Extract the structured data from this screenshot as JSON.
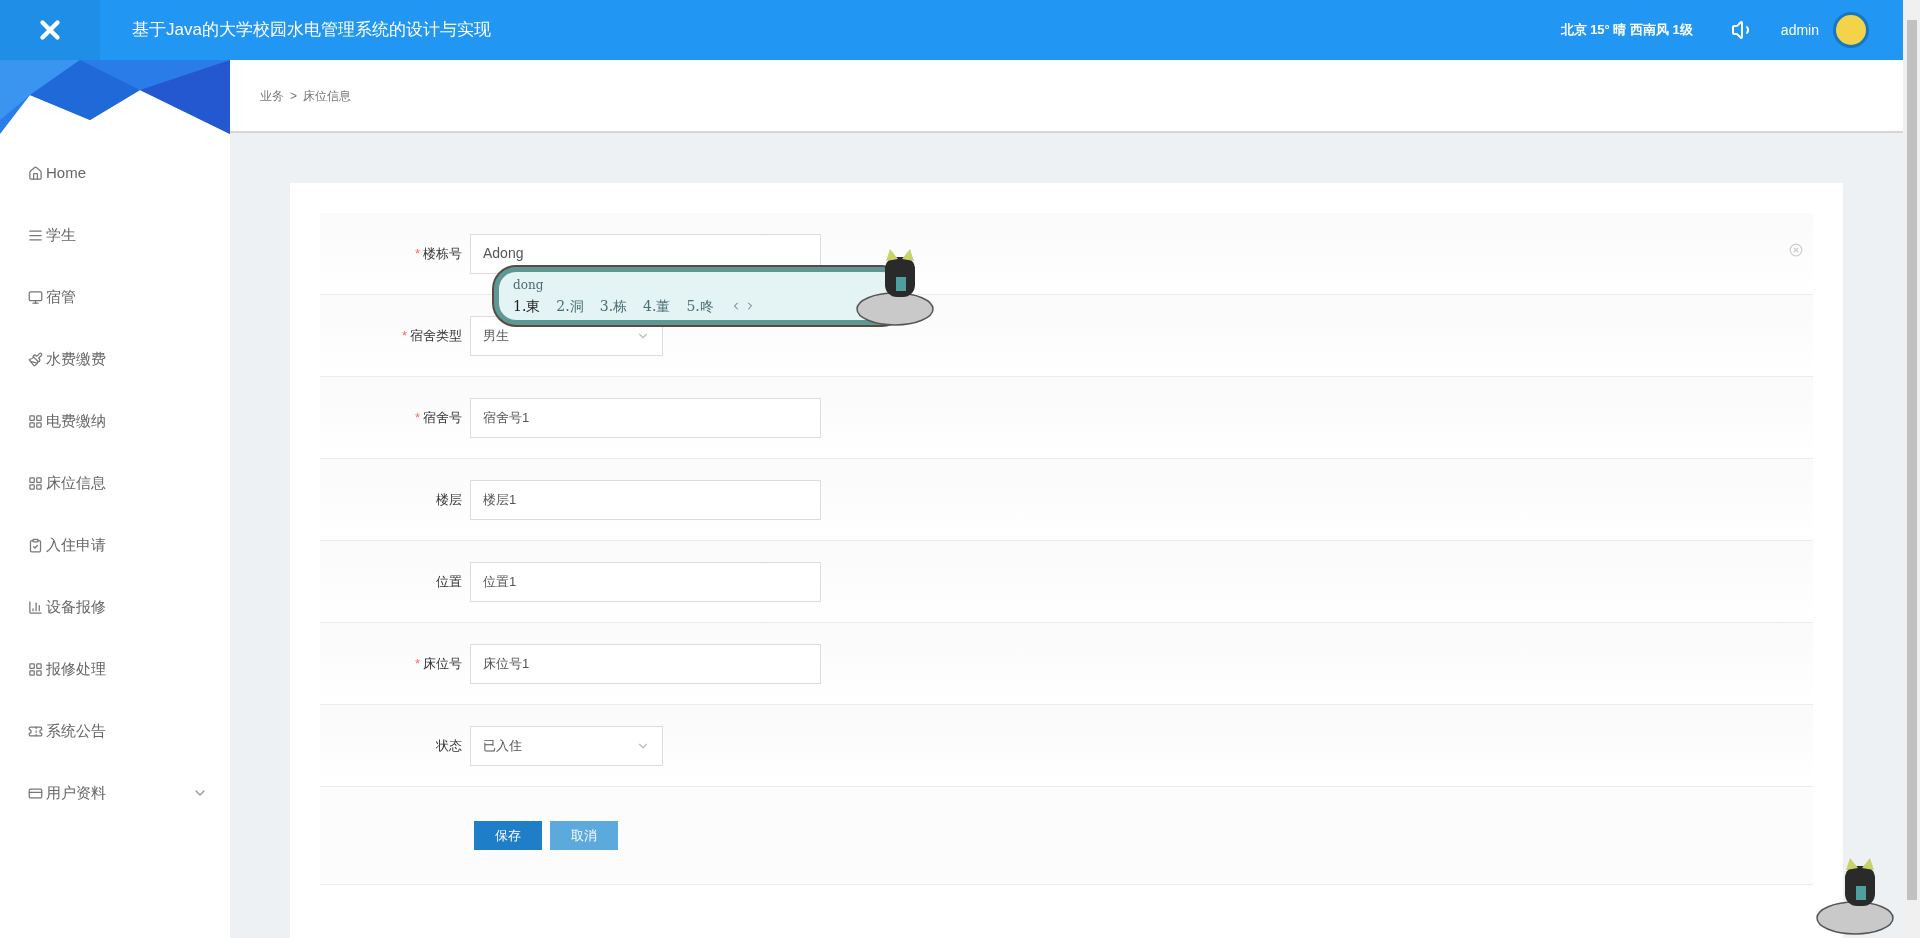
{
  "header": {
    "title": "基于Java的大学校园水电管理系统的设计与实现",
    "weather": "北京 15° 晴 西南风 1级",
    "user": "admin"
  },
  "breadcrumb": [
    "业务",
    ">",
    "床位信息"
  ],
  "sidebar": {
    "items": [
      {
        "label": "Home"
      },
      {
        "label": "学生"
      },
      {
        "label": "宿管"
      },
      {
        "label": "水费缴费"
      },
      {
        "label": "电费缴纳"
      },
      {
        "label": "床位信息"
      },
      {
        "label": "入住申请"
      },
      {
        "label": "设备报修"
      },
      {
        "label": "报修处理"
      },
      {
        "label": "系统公告"
      },
      {
        "label": "用户资料",
        "expandable": true
      }
    ]
  },
  "form": {
    "fields": [
      {
        "label": "楼栋号",
        "mark": "*",
        "kind": "text",
        "value": "Adong"
      },
      {
        "label": "宿舍类型",
        "mark": "*",
        "kind": "select",
        "value": "男生"
      },
      {
        "label": "宿舍号",
        "mark": "*",
        "kind": "text",
        "value": "宿舍号1"
      },
      {
        "label": "楼层",
        "kind": "text",
        "value": "楼层1"
      },
      {
        "label": "位置",
        "kind": "text",
        "value": "位置1"
      },
      {
        "label": "床位号",
        "mark": "*",
        "kind": "text",
        "value": "床位号1"
      },
      {
        "label": "状态",
        "kind": "select",
        "value": "已入住"
      }
    ],
    "buttons": [
      {
        "label": "保存",
        "kind": "primary"
      },
      {
        "label": "取消",
        "kind": "secondary"
      }
    ]
  },
  "ime": {
    "composition": "dong",
    "candidates": [
      "1.東",
      "2.洞",
      "3.栋",
      "4.董",
      "5.咚"
    ]
  }
}
